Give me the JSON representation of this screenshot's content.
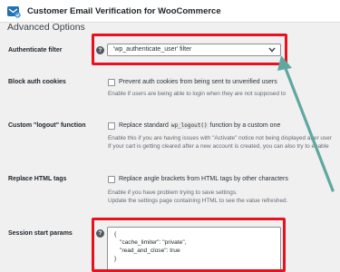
{
  "header": {
    "title": "Customer Email Verification for WooCommerce",
    "brand_color": "#2271b1"
  },
  "section": {
    "title": "Advanced Options"
  },
  "authenticate_filter": {
    "label": "Authenticate filter",
    "help_icon": "question-icon",
    "selected_value": "'wp_authenticate_user' filter"
  },
  "block_auth_cookies": {
    "label": "Block auth cookies",
    "checkbox_label": "Prevent auth cookies from being sent to unverified users",
    "checked": false,
    "help": "Enable if users are being able to login when they are not supposed to"
  },
  "custom_logout": {
    "label": "Custom \"logout\" function",
    "checkbox_label_before": "Replace standard",
    "checkbox_code": "wp_logout()",
    "checkbox_label_after": "function by a custom one",
    "checked": false,
    "help_line1": "Enable this if you are having issues with \"Activate\" notice not being displayed after user",
    "help_line2": "If your cart is getting cleared after a new account is created, you can also try to enable"
  },
  "replace_html_tags": {
    "label": "Replace HTML tags",
    "checkbox_label": "Replace angle brackets from HTML tags by other characters",
    "checked": false,
    "help_line1": "Enable if you have problem trying to save settings.",
    "help_line2": "Update the settings page containing HTML to see the value refreshed."
  },
  "session_start_params": {
    "label": "Session start params",
    "help_icon": "question-icon",
    "lines": [
      "{",
      "\"cache_limiter\": \"private\",",
      "\"read_and_close\": true",
      "}"
    ]
  },
  "annotation": {
    "highlight_color": "#e8121e",
    "arrow_color": "#5fa8a0"
  }
}
